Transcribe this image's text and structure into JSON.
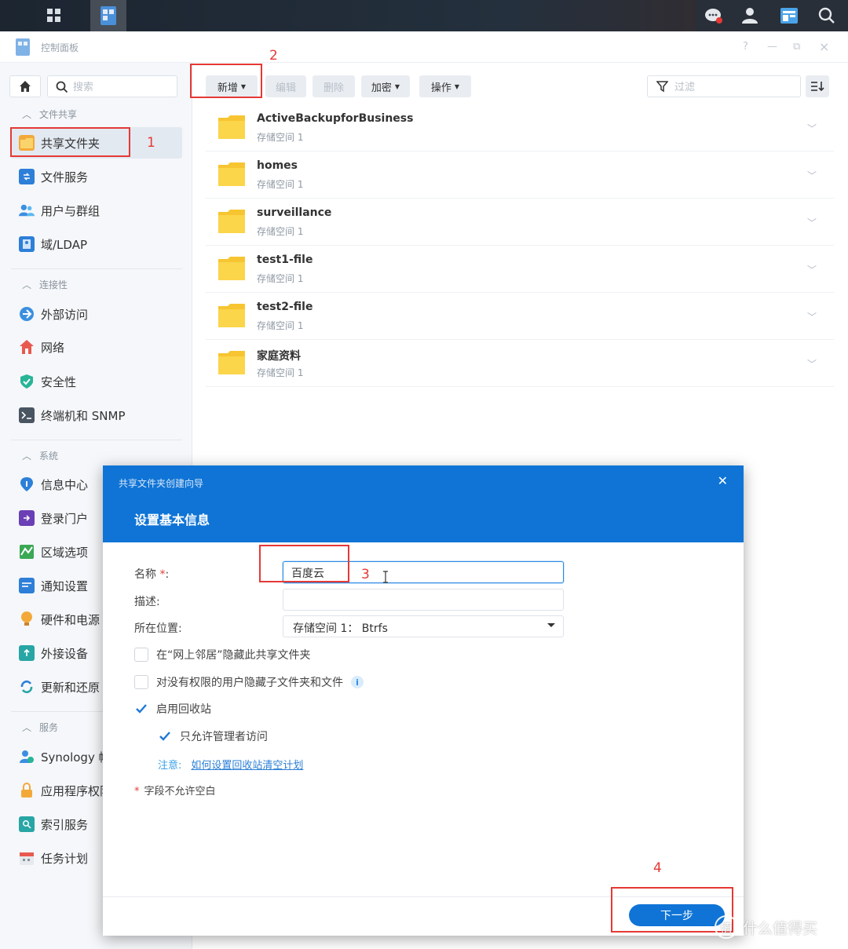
{
  "window": {
    "title": "控制面板",
    "help": "?",
    "minimize": "—",
    "restore": "⧉",
    "close": "×"
  },
  "sidebar": {
    "search_placeholder": "搜索",
    "sections": [
      {
        "label": "文件共享"
      },
      {
        "label": "连接性"
      },
      {
        "label": "系统"
      },
      {
        "label": "服务"
      }
    ],
    "items": [
      {
        "label": "共享文件夹"
      },
      {
        "label": "文件服务"
      },
      {
        "label": "用户与群组"
      },
      {
        "label": "域/LDAP"
      },
      {
        "label": "外部访问"
      },
      {
        "label": "网络"
      },
      {
        "label": "安全性"
      },
      {
        "label": "终端机和 SNMP"
      },
      {
        "label": "信息中心"
      },
      {
        "label": "登录门户"
      },
      {
        "label": "区域选项"
      },
      {
        "label": "通知设置"
      },
      {
        "label": "硬件和电源"
      },
      {
        "label": "外接设备"
      },
      {
        "label": "更新和还原"
      },
      {
        "label": "Synology 帐"
      },
      {
        "label": "应用程序权限"
      },
      {
        "label": "索引服务"
      },
      {
        "label": "任务计划"
      }
    ]
  },
  "toolbar": {
    "create": "新增",
    "edit": "编辑",
    "delete": "删除",
    "encrypt": "加密",
    "action": "操作",
    "filter_placeholder": "过滤"
  },
  "folders": [
    {
      "name": "ActiveBackupforBusiness",
      "volume": "存储空间 1"
    },
    {
      "name": "homes",
      "volume": "存储空间 1"
    },
    {
      "name": "surveillance",
      "volume": "存储空间 1"
    },
    {
      "name": "test1-file",
      "volume": "存储空间 1"
    },
    {
      "name": "test2-file",
      "volume": "存储空间 1"
    },
    {
      "name": "家庭资料",
      "volume": "存储空间 1"
    }
  ],
  "dialog": {
    "wizard_title": "共享文件夹创建向导",
    "step_title": "设置基本信息",
    "name_label": "名称",
    "name_req": "*",
    "name_colon": ":",
    "name_value": "百度云",
    "desc_label": "描述:",
    "desc_value": "",
    "location_label": "所在位置:",
    "location_value": "存储空间 1：  Btrfs",
    "hide_network": "在“网上邻居”隐藏此共享文件夹",
    "hide_subfolders": "对没有权限的用户隐藏子文件夹和文件",
    "info_icon_glyph": "i",
    "enable_recycle": "启用回收站",
    "admin_only": "只允许管理者访问",
    "note_label": "注意:",
    "note_link": "如何设置回收站清空计划",
    "required_star": "*",
    "required_note": "字段不允许空白",
    "next_button": "下一步"
  },
  "annotations": {
    "n1": "1",
    "n2": "2",
    "n3": "3",
    "n4": "4"
  },
  "watermark": {
    "logo": "值",
    "text": "什么值得买"
  },
  "colors": {
    "accent": "#0f74d6",
    "annotation": "#e53935",
    "folder": "#f7c531"
  }
}
